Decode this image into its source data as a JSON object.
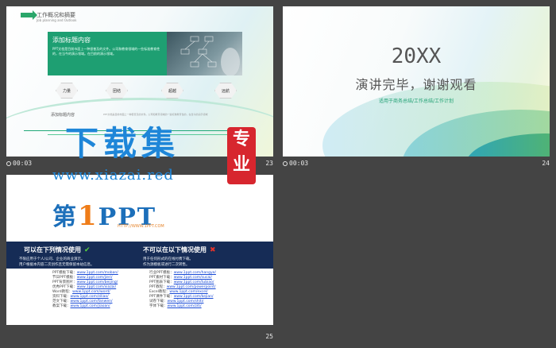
{
  "slides": [
    {
      "number": "23",
      "time": "00:03",
      "header_title": "工作概况和摘要",
      "header_sub": "Job planning and Outlook",
      "box_title": "添加标题内容",
      "box_text": "PPT文档是目前市面上一种很普及的文件。公司和教育领域的一些标准教育性的，在当今的演示领域。在目前的演示领域。",
      "hexagons": [
        "力量",
        "团结",
        "超越",
        "远航"
      ],
      "bottom_title": "添加标题内容",
      "bottom_text": "PPT文档是目前市面上一种很普及的文件。公司和教育领域的一些标准教育性的，在当今的演示领域"
    },
    {
      "number": "24",
      "time": "00:03",
      "year": "20XX",
      "thanks": "演讲完毕，谢谢观看",
      "subtitle": "适用于商务总结/工作总结/工作计划"
    },
    {
      "number": "25",
      "logo_first": "第",
      "logo_one": "1",
      "logo_rest": "PPT",
      "logo_url": "HTTP://WWW.1PPT.COM",
      "can_title": "可以在下列情况使用",
      "cannot_title": "不可以在以下情况使用",
      "can_rules": [
        "不限应用于个人/公司、企业的商业演示。",
        "用户根据本内容二次创作且无需保留本站信息。"
      ],
      "cannot_rules": [
        "用于任何形式的在线付费下载。",
        "作为源模板或进行二次转售。"
      ],
      "links_left": [
        {
          "label": "PPT模板下载：",
          "url": "www.1ppt.com/moban/"
        },
        {
          "label": "节日PPT模板：",
          "url": "www.1ppt.com/jieri/"
        },
        {
          "label": "PPT背景图片：",
          "url": "www.1ppt.com/beijing/"
        },
        {
          "label": "优秀PPT下载：",
          "url": "www.1ppt.com/xiazai/"
        },
        {
          "label": "Word教程：",
          "url": "www.1ppt.com/word/"
        },
        {
          "label": "资料下载：",
          "url": "www.1ppt.com/ziliao/"
        },
        {
          "label": "范文下载：",
          "url": "www.1ppt.com/fanwen/"
        },
        {
          "label": "教案下载：",
          "url": "www.1ppt.com/jiaoan/"
        }
      ],
      "links_right": [
        {
          "label": "行业PPT模板：",
          "url": "www.1ppt.com/hangye/"
        },
        {
          "label": "PPT素材下载：",
          "url": "www.1ppt.com/sucai/"
        },
        {
          "label": "PPT图表下载：",
          "url": "www.1ppt.com/tubiao/"
        },
        {
          "label": "PPT教程：",
          "url": "www.1ppt.com/powerpoint/"
        },
        {
          "label": "Excel教程：",
          "url": "www.1ppt.com/excel/"
        },
        {
          "label": "PPT课件下载：",
          "url": "www.1ppt.com/kejian/"
        },
        {
          "label": "试卷下载：",
          "url": "www.1ppt.com/shiti/"
        },
        {
          "label": "字体下载：",
          "url": "www.1ppt.com/ziti/"
        }
      ]
    }
  ],
  "watermark": {
    "text": "下载集",
    "url": "www.xiazai.red",
    "seal": "专业"
  }
}
